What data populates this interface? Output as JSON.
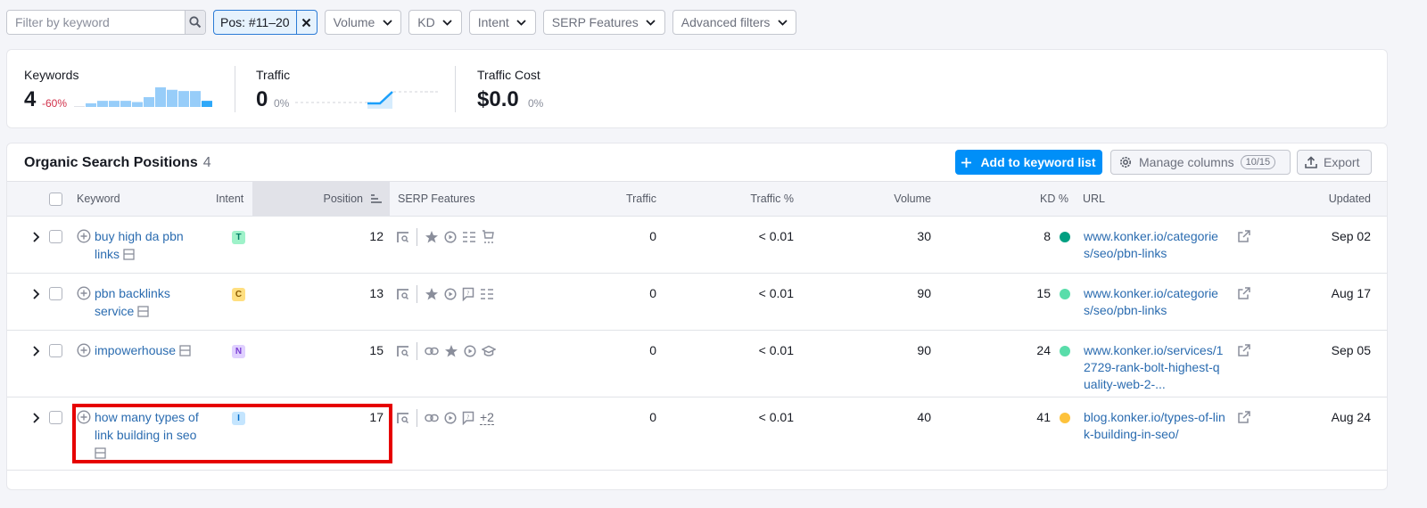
{
  "filters": {
    "search_placeholder": "Filter by keyword",
    "search_value": "",
    "active_filter": "Pos: #11–20",
    "dropdowns": [
      "Volume",
      "KD",
      "Intent",
      "SERP Features",
      "Advanced filters"
    ]
  },
  "summary": {
    "keywords": {
      "label": "Keywords",
      "value": "4",
      "delta": "-60%",
      "delta_color": "#d1304a",
      "sparkline": [
        0.5,
        3,
        5,
        5,
        5,
        4,
        8,
        16,
        14,
        13,
        13,
        5
      ]
    },
    "traffic": {
      "label": "Traffic",
      "value": "0",
      "delta": "0%"
    },
    "traffic_cost": {
      "label": "Traffic Cost",
      "value": "$0.0",
      "delta": "0%"
    }
  },
  "table": {
    "title": "Organic Search Positions",
    "count": "4",
    "add_button": "Add to keyword list",
    "manage_columns": "Manage columns",
    "manage_columns_count": "10/15",
    "export": "Export",
    "columns": {
      "keyword": "Keyword",
      "intent": "Intent",
      "position": "Position",
      "serp": "SERP Features",
      "traffic": "Traffic",
      "traffic_pct": "Traffic %",
      "volume": "Volume",
      "kd": "KD %",
      "url": "URL",
      "updated": "Updated"
    },
    "rows": [
      {
        "keyword": "buy high da pbn links",
        "intent": "T",
        "intent_bg": "#9ef2c9",
        "intent_fg": "#007c65",
        "position": "12",
        "serp": [
          "serp-snippet",
          "divider",
          "star",
          "video",
          "list",
          "shopping"
        ],
        "traffic": "0",
        "traffic_pct": "< 0.01",
        "volume": "30",
        "kd": "8",
        "kd_color": "#009f81",
        "url": "www.konker.io/categories/seo/pbn-links",
        "updated": "Sep 02"
      },
      {
        "keyword": "pbn backlinks service",
        "intent": "C",
        "intent_bg": "#ffdf80",
        "intent_fg": "#8a5b00",
        "position": "13",
        "serp": [
          "serp-snippet",
          "divider",
          "star",
          "video",
          "faq",
          "list"
        ],
        "traffic": "0",
        "traffic_pct": "< 0.01",
        "volume": "90",
        "kd": "15",
        "kd_color": "#59ddaa",
        "url": "www.konker.io/categories/seo/pbn-links",
        "updated": "Aug 17"
      },
      {
        "keyword": "impowerhouse",
        "intent": "N",
        "intent_bg": "#e0d0ff",
        "intent_fg": "#7a3ed4",
        "position": "15",
        "serp": [
          "serp-snippet",
          "divider",
          "link",
          "star",
          "video",
          "education"
        ],
        "traffic": "0",
        "traffic_pct": "< 0.01",
        "volume": "90",
        "kd": "24",
        "kd_color": "#59ddaa",
        "url": "www.konker.io/services/12729-rank-bolt-highest-quality-web-2-...",
        "updated": "Sep 05"
      },
      {
        "keyword": "how many types of link building in seo",
        "intent": "I",
        "intent_bg": "#c4e5fe",
        "intent_fg": "#006dca",
        "position": "17",
        "serp": [
          "serp-snippet",
          "divider",
          "link",
          "video",
          "faq"
        ],
        "serp_more": "+2",
        "traffic": "0",
        "traffic_pct": "< 0.01",
        "volume": "40",
        "kd": "41",
        "kd_color": "#fdc23c",
        "url": "blog.konker.io/types-of-link-building-in-seo/",
        "updated": "Aug 24"
      }
    ]
  }
}
